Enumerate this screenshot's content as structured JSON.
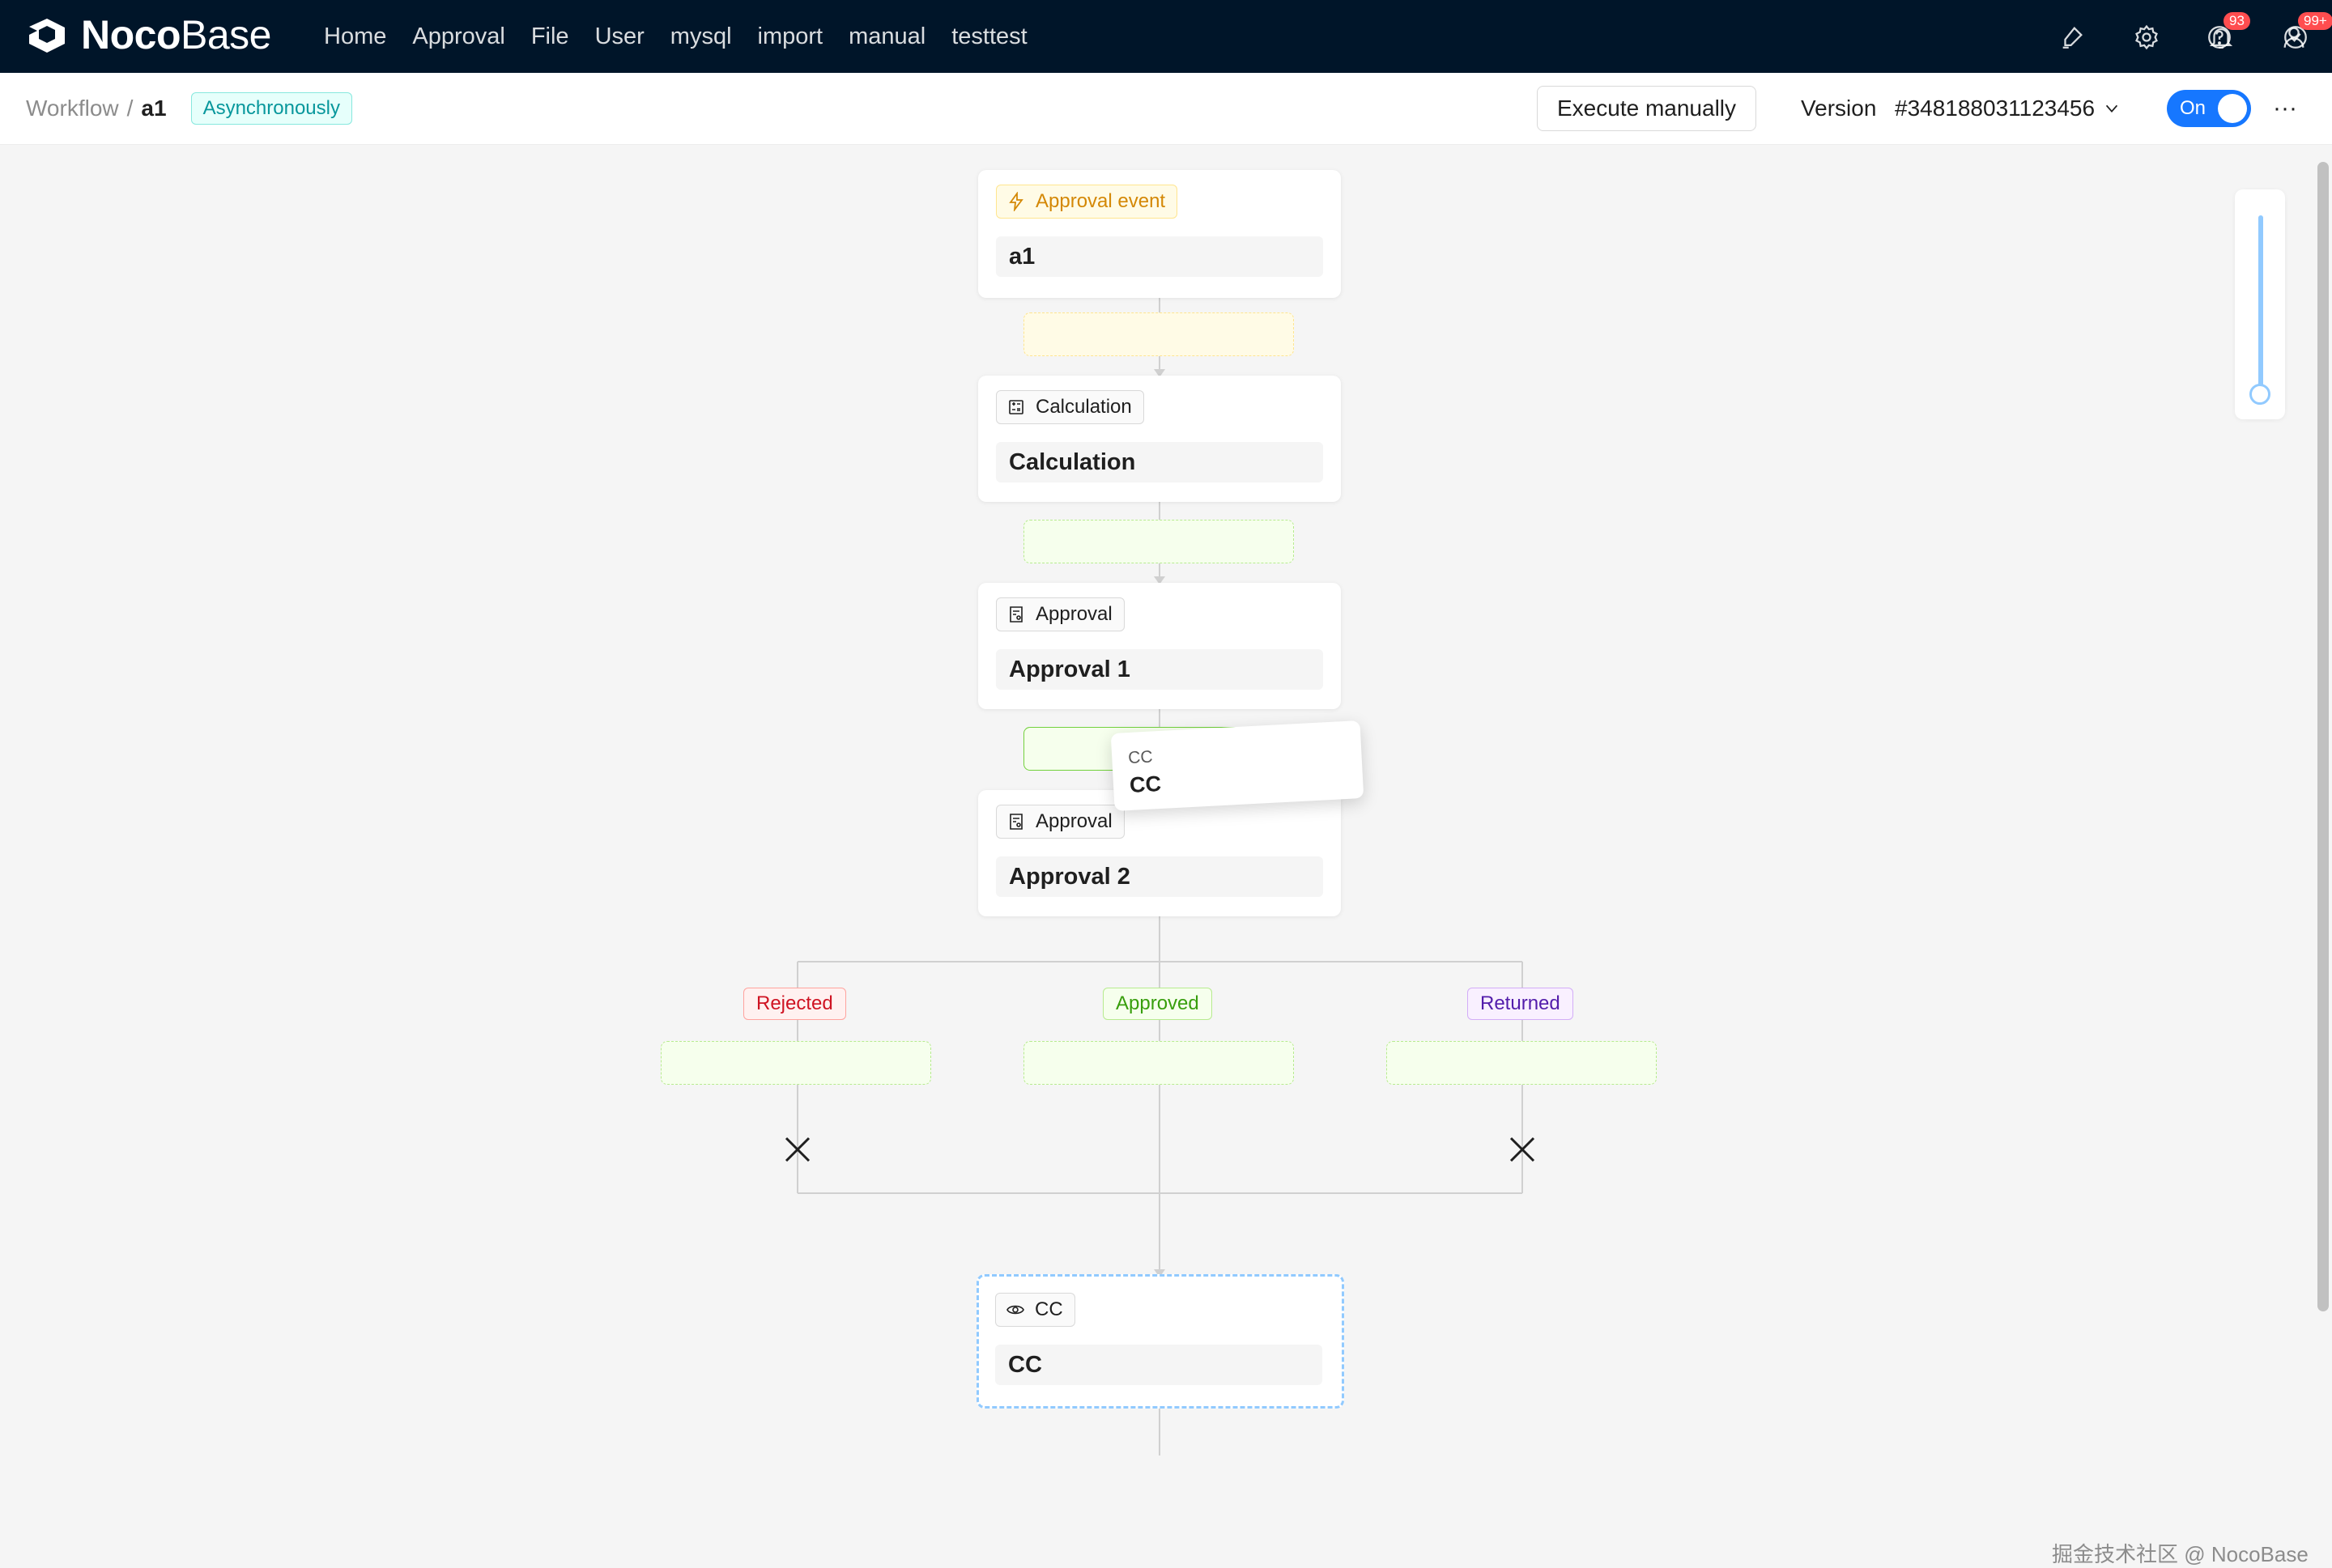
{
  "app": {
    "logo_bold": "Noco",
    "logo_light": "Base",
    "nav": [
      "Home",
      "Approval",
      "File",
      "User",
      "mysql",
      "import",
      "manual",
      "testtest"
    ],
    "icons": [
      "highlighter-icon",
      "gear-icon",
      "bell-icon",
      "check-circle-icon",
      "help-icon",
      "user-icon"
    ],
    "notification_badge": "93",
    "todo_badge": "99+"
  },
  "subheader": {
    "breadcrumb_root": "Workflow",
    "breadcrumb_sep": "/",
    "breadcrumb_current": "a1",
    "mode_tag": "Asynchronously",
    "execute_button": "Execute manually",
    "version_label": "Version",
    "version_value": "#348188031123456",
    "toggle_label": "On",
    "more_label": "···"
  },
  "workflow": {
    "trigger": {
      "type": "Approval event",
      "title": "a1",
      "icon": "lightning-icon"
    },
    "nodes": [
      {
        "type": "Calculation",
        "title": "Calculation",
        "icon": "calculator-icon"
      },
      {
        "type": "Approval",
        "title": "Approval 1",
        "icon": "approval-doc-icon"
      },
      {
        "type": "Approval",
        "title": "Approval 2",
        "icon": "approval-doc-icon"
      }
    ],
    "branches": [
      "Rejected",
      "Approved",
      "Returned"
    ],
    "cc_node": {
      "type": "CC",
      "title": "CC",
      "icon": "eye-icon"
    },
    "drag_ghost": {
      "type": "CC",
      "title": "CC"
    }
  },
  "colors": {
    "header_bg": "#001529",
    "primary": "#1677ff",
    "rejected": "#cf1322",
    "approved": "#389e0d",
    "returned": "#531dab",
    "trigger": "#d48806"
  },
  "watermark": "掘金技术社区 @ NocoBase"
}
